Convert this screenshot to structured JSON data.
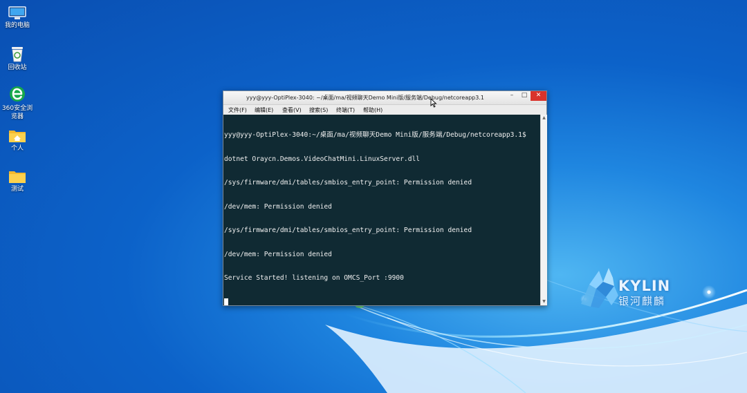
{
  "desktop": {
    "icons": [
      {
        "label": "我的电脑",
        "icon": "computer-icon"
      },
      {
        "label": "回收站",
        "icon": "recycle-bin-icon"
      },
      {
        "label": "360安全浏览器",
        "icon": "browser-360-icon"
      },
      {
        "label": "个人",
        "icon": "home-folder-icon"
      },
      {
        "label": "测试",
        "icon": "folder-icon"
      }
    ],
    "brand": {
      "latin": "KYLIN",
      "chinese": "银河麒麟"
    }
  },
  "terminal": {
    "title": "yyy@yyy-OptiPlex-3040: ~/桌面/ma/视频聊天Demo Mini版/服务端/Debug/netcoreapp3.1",
    "buttons": {
      "minimize": "–",
      "maximize": "□",
      "close": "✕"
    },
    "menu": [
      "文件(F)",
      "编辑(E)",
      "查看(V)",
      "搜索(S)",
      "终端(T)",
      "帮助(H)"
    ],
    "lines": [
      "yyy@yyy-OptiPlex-3040:~/桌面/ma/视频聊天Demo Mini版/服务端/Debug/netcoreapp3.1$",
      "dotnet Oraycn.Demos.VideoChatMini.LinuxServer.dll",
      "/sys/firmware/dmi/tables/smbios_entry_point: Permission denied",
      "/dev/mem: Permission denied",
      "/sys/firmware/dmi/tables/smbios_entry_point: Permission denied",
      "/dev/mem: Permission denied",
      "Service Started! listening on OMCS_Port :9900"
    ]
  },
  "colors": {
    "desktop_blue": "#0c62c9",
    "terminal_bg": "#102a33",
    "terminal_fg": "#f0f0f0",
    "close_red": "#d9332b"
  }
}
